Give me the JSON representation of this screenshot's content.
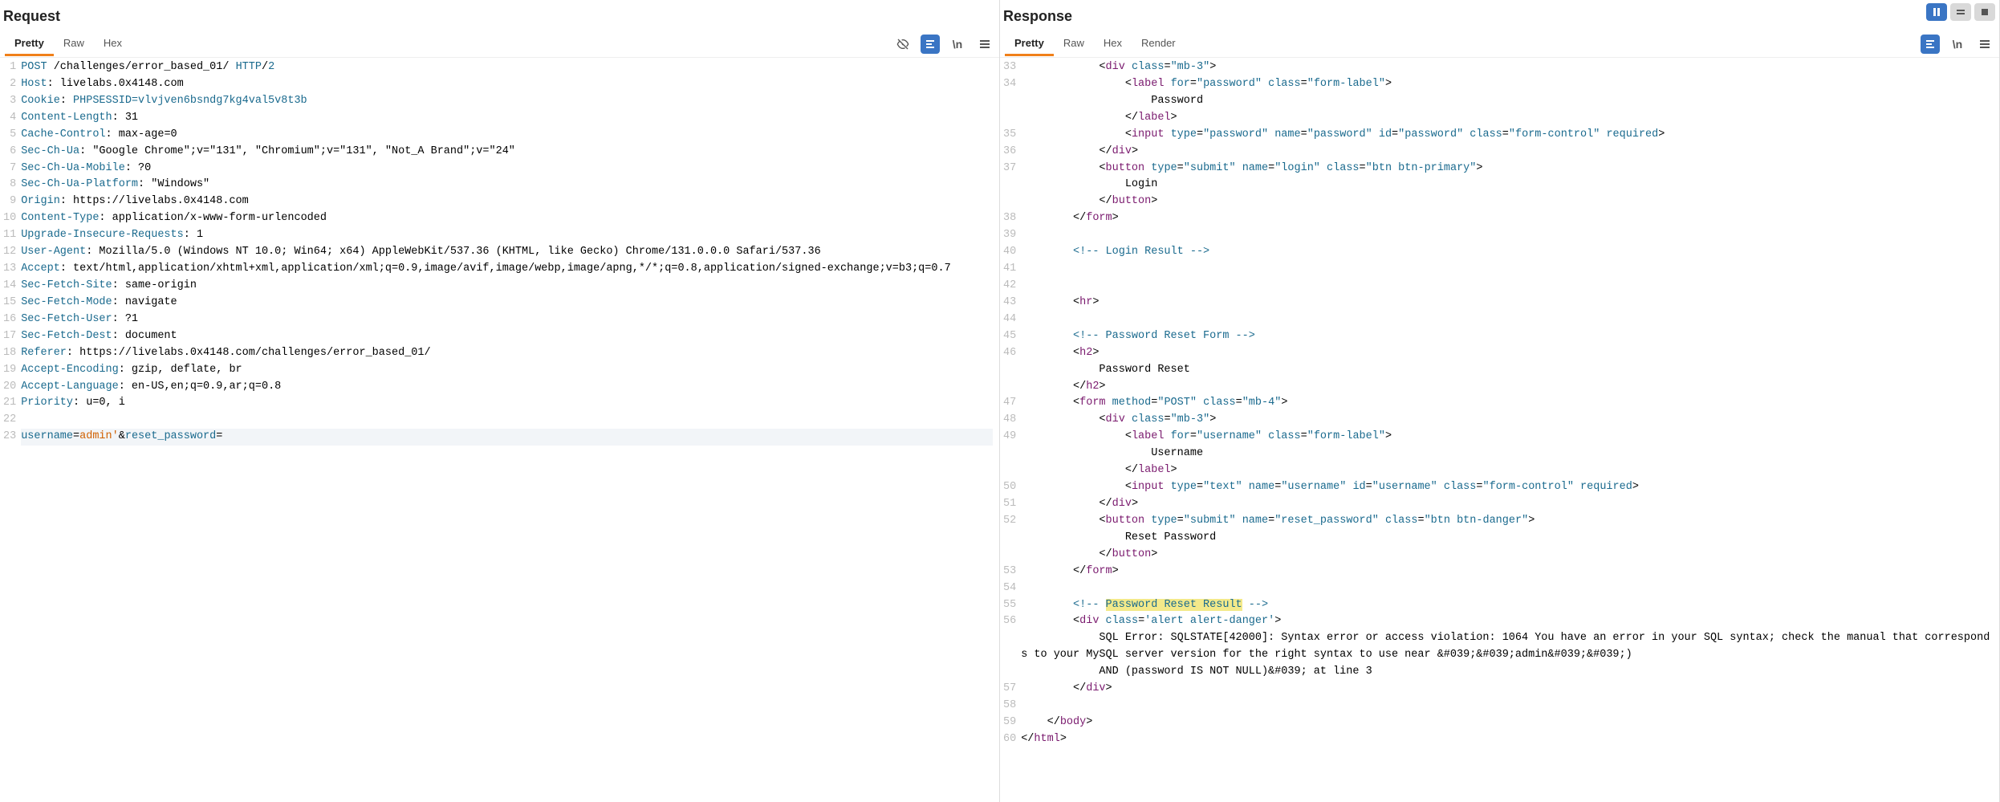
{
  "request": {
    "title": "Request",
    "tabs": [
      "Pretty",
      "Raw",
      "Hex"
    ],
    "active_tab": "Pretty",
    "lines": [
      {
        "n": "1",
        "html": "<span class='t-key'>POST</span> /challenges/error_based_01/ <span class='t-key'>HTTP</span>/<span class='t-key'>2</span>"
      },
      {
        "n": "2",
        "html": "<span class='t-key'>Host</span>: livelabs.0x4148.com"
      },
      {
        "n": "3",
        "html": "<span class='t-key'>Cookie</span>: <span class='t-key'>PHPSESSID=vlvjven6bsndg7kg4val5v8t3b</span>"
      },
      {
        "n": "4",
        "html": "<span class='t-key'>Content-Length</span>: 31"
      },
      {
        "n": "5",
        "html": "<span class='t-key'>Cache-Control</span>: max-age=0"
      },
      {
        "n": "6",
        "html": "<span class='t-key'>Sec-Ch-Ua</span>: \"Google Chrome\";v=\"131\", \"Chromium\";v=\"131\", \"Not_A Brand\";v=\"24\""
      },
      {
        "n": "7",
        "html": "<span class='t-key'>Sec-Ch-Ua-Mobile</span>: ?0"
      },
      {
        "n": "8",
        "html": "<span class='t-key'>Sec-Ch-Ua-Platform</span>: \"Windows\""
      },
      {
        "n": "9",
        "html": "<span class='t-key'>Origin</span>: https://livelabs.0x4148.com"
      },
      {
        "n": "10",
        "html": "<span class='t-key'>Content-Type</span>: application/x-www-form-urlencoded"
      },
      {
        "n": "11",
        "html": "<span class='t-key'>Upgrade-Insecure-Requests</span>: 1"
      },
      {
        "n": "12",
        "html": "<span class='t-key'>User-Agent</span>: Mozilla/5.0 (Windows NT 10.0; Win64; x64) AppleWebKit/537.36 (KHTML, like Gecko) Chrome/131.0.0.0 Safari/537.36"
      },
      {
        "n": "13",
        "html": "<span class='t-key'>Accept</span>: text/html,application/xhtml+xml,application/xml;q=0.9,image/avif,image/webp,image/apng,*/*;q=0.8,application/signed-exchange;v=b3;q=0.7"
      },
      {
        "n": "14",
        "html": "<span class='t-key'>Sec-Fetch-Site</span>: same-origin"
      },
      {
        "n": "15",
        "html": "<span class='t-key'>Sec-Fetch-Mode</span>: navigate"
      },
      {
        "n": "16",
        "html": "<span class='t-key'>Sec-Fetch-User</span>: ?1"
      },
      {
        "n": "17",
        "html": "<span class='t-key'>Sec-Fetch-Dest</span>: document"
      },
      {
        "n": "18",
        "html": "<span class='t-key'>Referer</span>: https://livelabs.0x4148.com/challenges/error_based_01/"
      },
      {
        "n": "19",
        "html": "<span class='t-key'>Accept-Encoding</span>: gzip, deflate, br"
      },
      {
        "n": "20",
        "html": "<span class='t-key'>Accept-Language</span>: en-US,en;q=0.9,ar;q=0.8"
      },
      {
        "n": "21",
        "html": "<span class='t-key'>Priority</span>: u=0, i"
      },
      {
        "n": "22",
        "html": ""
      },
      {
        "n": "23",
        "html": "<span class='hl-body'><span class='t-key'>username</span>=<span class='t-orange'>admin'</span>&amp;<span class='t-key'>reset_password</span>=</span>"
      }
    ]
  },
  "response": {
    "title": "Response",
    "tabs": [
      "Pretty",
      "Raw",
      "Hex",
      "Render"
    ],
    "active_tab": "Pretty",
    "lines": [
      {
        "n": "33",
        "html": "            &lt;<span class='t-tag'>div</span> <span class='t-attr'>class</span>=<span class='t-qstr'>\"mb-3\"</span>&gt;"
      },
      {
        "n": "34",
        "html": "                &lt;<span class='t-tag'>label</span> <span class='t-attr'>for</span>=<span class='t-qstr'>\"password\"</span> <span class='t-attr'>class</span>=<span class='t-qstr'>\"form-label\"</span>&gt;\n                    Password\n                &lt;/<span class='t-tag'>label</span>&gt;"
      },
      {
        "n": "35",
        "html": "                &lt;<span class='t-tag'>input</span> <span class='t-attr'>type</span>=<span class='t-qstr'>\"password\"</span> <span class='t-attr'>name</span>=<span class='t-qstr'>\"password\"</span> <span class='t-attr'>id</span>=<span class='t-qstr'>\"password\"</span> <span class='t-attr'>class</span>=<span class='t-qstr'>\"form-control\"</span> <span class='t-attr'>required</span>&gt;"
      },
      {
        "n": "36",
        "html": "            &lt;/<span class='t-tag'>div</span>&gt;"
      },
      {
        "n": "37",
        "html": "            &lt;<span class='t-tag'>button</span> <span class='t-attr'>type</span>=<span class='t-qstr'>\"submit\"</span> <span class='t-attr'>name</span>=<span class='t-qstr'>\"login\"</span> <span class='t-attr'>class</span>=<span class='t-qstr'>\"btn btn-primary\"</span>&gt;\n                Login\n            &lt;/<span class='t-tag'>button</span>&gt;"
      },
      {
        "n": "38",
        "html": "        &lt;/<span class='t-tag'>form</span>&gt;"
      },
      {
        "n": "39",
        "html": ""
      },
      {
        "n": "40",
        "html": "        <span class='t-cmt'>&lt;!-- Login Result --&gt;</span>"
      },
      {
        "n": "41",
        "html": "        "
      },
      {
        "n": "42",
        "html": ""
      },
      {
        "n": "43",
        "html": "        &lt;<span class='t-tag'>hr</span>&gt;"
      },
      {
        "n": "44",
        "html": ""
      },
      {
        "n": "45",
        "html": "        <span class='t-cmt'>&lt;!-- Password Reset Form --&gt;</span>"
      },
      {
        "n": "46",
        "html": "        &lt;<span class='t-tag'>h2</span>&gt;\n            Password Reset\n        &lt;/<span class='t-tag'>h2</span>&gt;"
      },
      {
        "n": "47",
        "html": "        &lt;<span class='t-tag'>form</span> <span class='t-attr'>method</span>=<span class='t-qstr'>\"POST\"</span> <span class='t-attr'>class</span>=<span class='t-qstr'>\"mb-4\"</span>&gt;"
      },
      {
        "n": "48",
        "html": "            &lt;<span class='t-tag'>div</span> <span class='t-attr'>class</span>=<span class='t-qstr'>\"mb-3\"</span>&gt;"
      },
      {
        "n": "49",
        "html": "                &lt;<span class='t-tag'>label</span> <span class='t-attr'>for</span>=<span class='t-qstr'>\"username\"</span> <span class='t-attr'>class</span>=<span class='t-qstr'>\"form-label\"</span>&gt;\n                    Username\n                &lt;/<span class='t-tag'>label</span>&gt;"
      },
      {
        "n": "50",
        "html": "                &lt;<span class='t-tag'>input</span> <span class='t-attr'>type</span>=<span class='t-qstr'>\"text\"</span> <span class='t-attr'>name</span>=<span class='t-qstr'>\"username\"</span> <span class='t-attr'>id</span>=<span class='t-qstr'>\"username\"</span> <span class='t-attr'>class</span>=<span class='t-qstr'>\"form-control\"</span> <span class='t-attr'>required</span>&gt;"
      },
      {
        "n": "51",
        "html": "            &lt;/<span class='t-tag'>div</span>&gt;"
      },
      {
        "n": "52",
        "html": "            &lt;<span class='t-tag'>button</span> <span class='t-attr'>type</span>=<span class='t-qstr'>\"submit\"</span> <span class='t-attr'>name</span>=<span class='t-qstr'>\"reset_password\"</span> <span class='t-attr'>class</span>=<span class='t-qstr'>\"btn btn-danger\"</span>&gt;\n                Reset Password\n            &lt;/<span class='t-tag'>button</span>&gt;"
      },
      {
        "n": "53",
        "html": "        &lt;/<span class='t-tag'>form</span>&gt;"
      },
      {
        "n": "54",
        "html": ""
      },
      {
        "n": "55",
        "html": "        <span class='t-cmt'>&lt;!-- <span class='hl-mark'>Password Reset Result</span> --&gt;</span>"
      },
      {
        "n": "56",
        "html": "        &lt;<span class='t-tag'>div</span> <span class='t-attr'>class</span>=<span class='t-qstr'>'alert alert-danger'</span>&gt;\n            SQL Error: SQLSTATE[42000]: Syntax error or access violation: 1064 You have an error in your SQL syntax; check the manual that corresponds to your MySQL server version for the right syntax to use near &amp;#039;&amp;#039;admin&amp;#039;&amp;#039;)\n            AND (password IS NOT NULL)&amp;#039; at line 3\n        &lt;/<span class='t-tag'>div</span>&gt;"
      },
      {
        "n": "57",
        "html": ""
      },
      {
        "n": "58",
        "html": "    &lt;/<span class='t-tag'>body</span>&gt;"
      },
      {
        "n": "59",
        "html": "&lt;/<span class='t-tag'>html</span>&gt;"
      },
      {
        "n": "60",
        "html": ""
      }
    ]
  },
  "icons": {
    "wrap_label": "\\n"
  }
}
